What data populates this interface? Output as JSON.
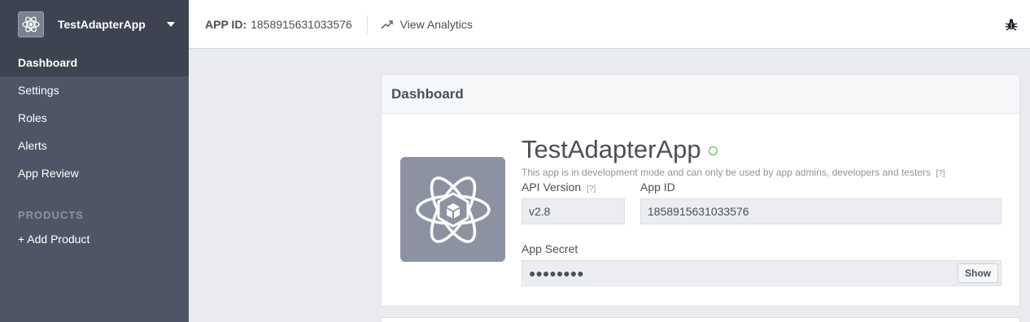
{
  "sidebar": {
    "app_name": "TestAdapterApp",
    "items": [
      {
        "label": "Dashboard"
      },
      {
        "label": "Settings"
      },
      {
        "label": "Roles"
      },
      {
        "label": "Alerts"
      },
      {
        "label": "App Review"
      }
    ],
    "products_heading": "PRODUCTS",
    "add_product": "+ Add Product"
  },
  "topbar": {
    "appid_label": "APP ID:",
    "appid_value": "1858915631033576",
    "analytics_label": "View Analytics"
  },
  "dashboard": {
    "header": "Dashboard",
    "app_title": "TestAdapterApp",
    "dev_note": "This app is in development mode and can only be used by app admins, developers and testers",
    "help_marker": "[?]",
    "api_version_label": "API Version",
    "api_version_value": "v2.8",
    "app_id_label": "App ID",
    "app_id_value": "1858915631033576",
    "app_secret_label": "App Secret",
    "app_secret_value": "●●●●●●●●",
    "show_label": "Show"
  },
  "colors": {
    "sidebar": "#4e5665",
    "sidebar_active": "#3d4350",
    "status_dot": "#42b72a"
  },
  "icons": [
    "atom-logo-icon",
    "chevron-down-icon",
    "trending-up-icon",
    "bug-icon"
  ]
}
